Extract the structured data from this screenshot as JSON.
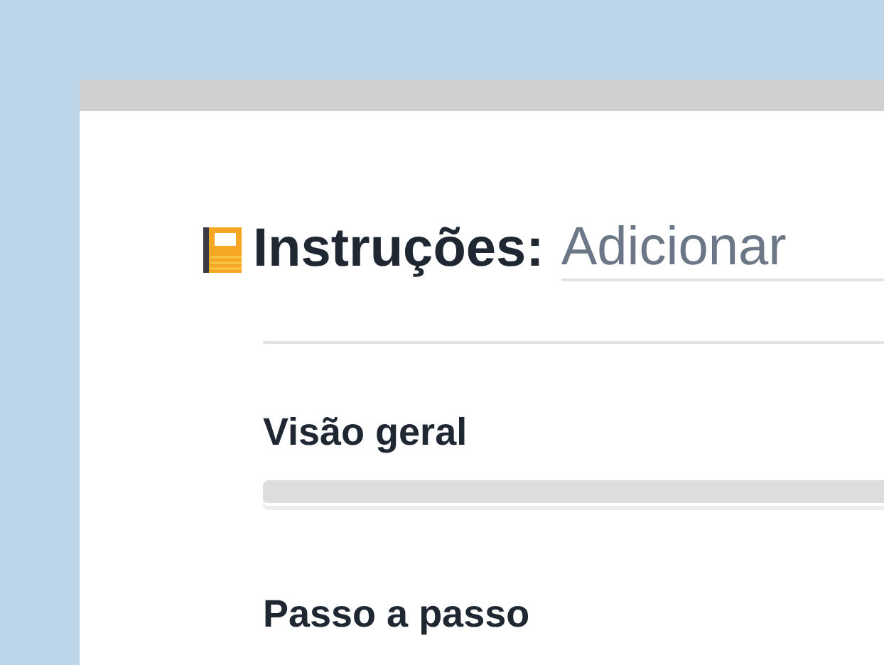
{
  "page": {
    "title": "Instruções:",
    "title_field": {
      "placeholder": "Adicionar"
    }
  },
  "sections": [
    {
      "heading": "Visão geral"
    },
    {
      "heading": "Passo a passo"
    }
  ]
}
